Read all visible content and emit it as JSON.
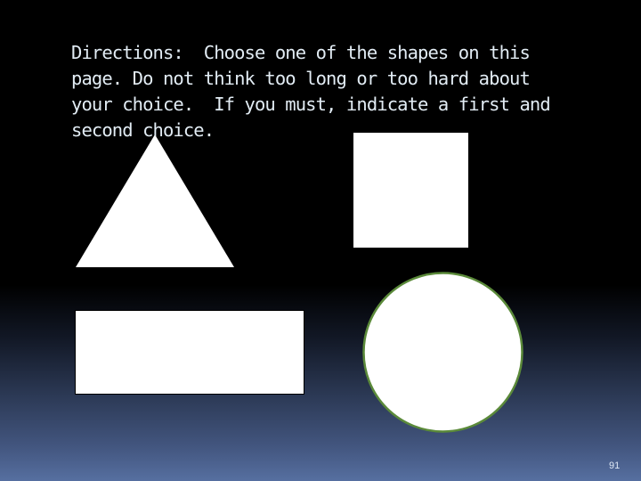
{
  "slide": {
    "directions_lines": [
      "Directions:  Choose one of the shapes on this",
      "page. Do not think too long or too hard about",
      "your choice.  If you must, indicate a first and",
      "second choice."
    ],
    "page_number": "91",
    "shapes": [
      {
        "name": "triangle",
        "fill": "#ffffff"
      },
      {
        "name": "square",
        "fill": "#ffffff"
      },
      {
        "name": "rectangle",
        "fill": "#ffffff"
      },
      {
        "name": "circle",
        "fill": "#ffffff",
        "stroke": "#5b8a3a"
      }
    ]
  }
}
